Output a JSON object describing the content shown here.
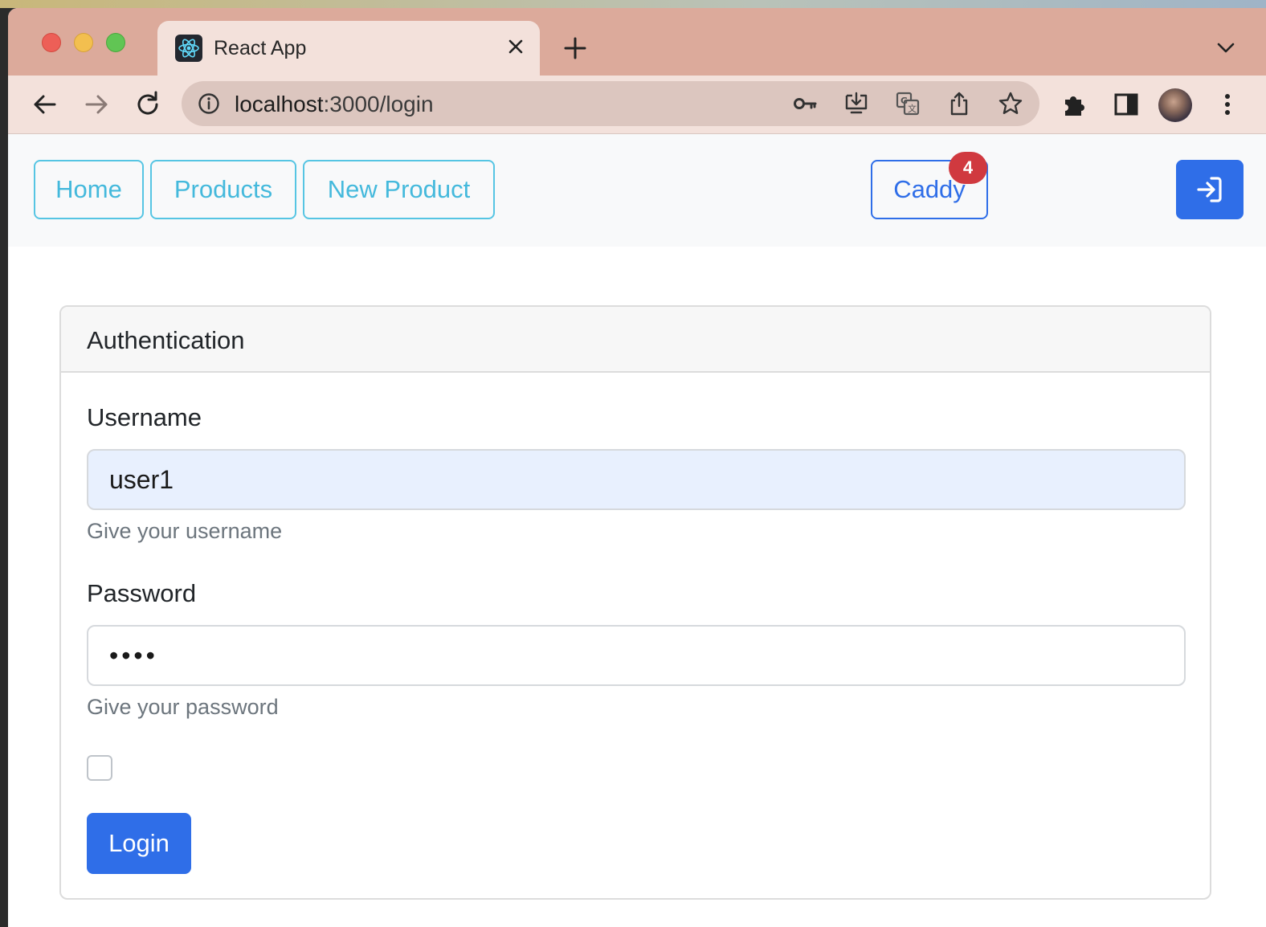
{
  "browser": {
    "tab_title": "React App",
    "url_host": "localhost",
    "url_rest": ":3000/login"
  },
  "nav": {
    "home": "Home",
    "products": "Products",
    "new_product": "New Product",
    "caddy": "Caddy",
    "caddy_count": "4"
  },
  "card": {
    "title": "Authentication",
    "username_label": "Username",
    "username_value": "user1",
    "username_help": "Give your username",
    "password_label": "Password",
    "password_value": "••••",
    "password_help": "Give your password",
    "submit_label": "Login"
  },
  "colors": {
    "primary": "#2f6ee8",
    "info": "#56c5e3",
    "danger": "#d0393f",
    "tabstrip": "#dcaa9b"
  }
}
